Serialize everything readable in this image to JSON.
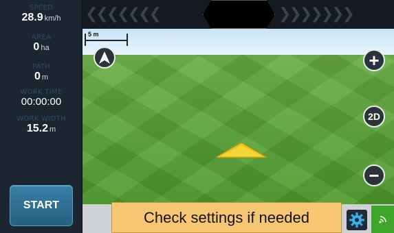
{
  "stats": {
    "speed": {
      "label": "SPEED",
      "value": "28.9",
      "unit": "km/h"
    },
    "area": {
      "label": "AREA",
      "value": "0",
      "unit": "ha"
    },
    "path": {
      "label": "PATH",
      "value": "0",
      "unit": "m"
    },
    "work_time": {
      "label": "WORK TIME",
      "value": "00:00:00"
    },
    "work_width": {
      "label": "WORK WIDTH",
      "value": "15.2",
      "unit": "m"
    }
  },
  "start_button": {
    "label": "START"
  },
  "top_bar": {
    "left_chevrons": "❮❮❮❮❮❮❮",
    "right_chevrons": "❯❯❯❯❯❯❯"
  },
  "map": {
    "scale_label": "5 m",
    "zoom_in_label": "+",
    "zoom_out_label": "−",
    "view_mode_label": "2D",
    "compass_icon": "navigation-arrow-icon"
  },
  "message": {
    "text": "Check settings if needed"
  },
  "icons": {
    "settings": "gear-icon",
    "signal": "signal-icon",
    "panel_toggle": "chevron-left-icon"
  },
  "colors": {
    "accent": "#2f6f94",
    "message_bg": "#f7c673",
    "field": "#5fa13c",
    "vehicle": "#e8c51e"
  }
}
